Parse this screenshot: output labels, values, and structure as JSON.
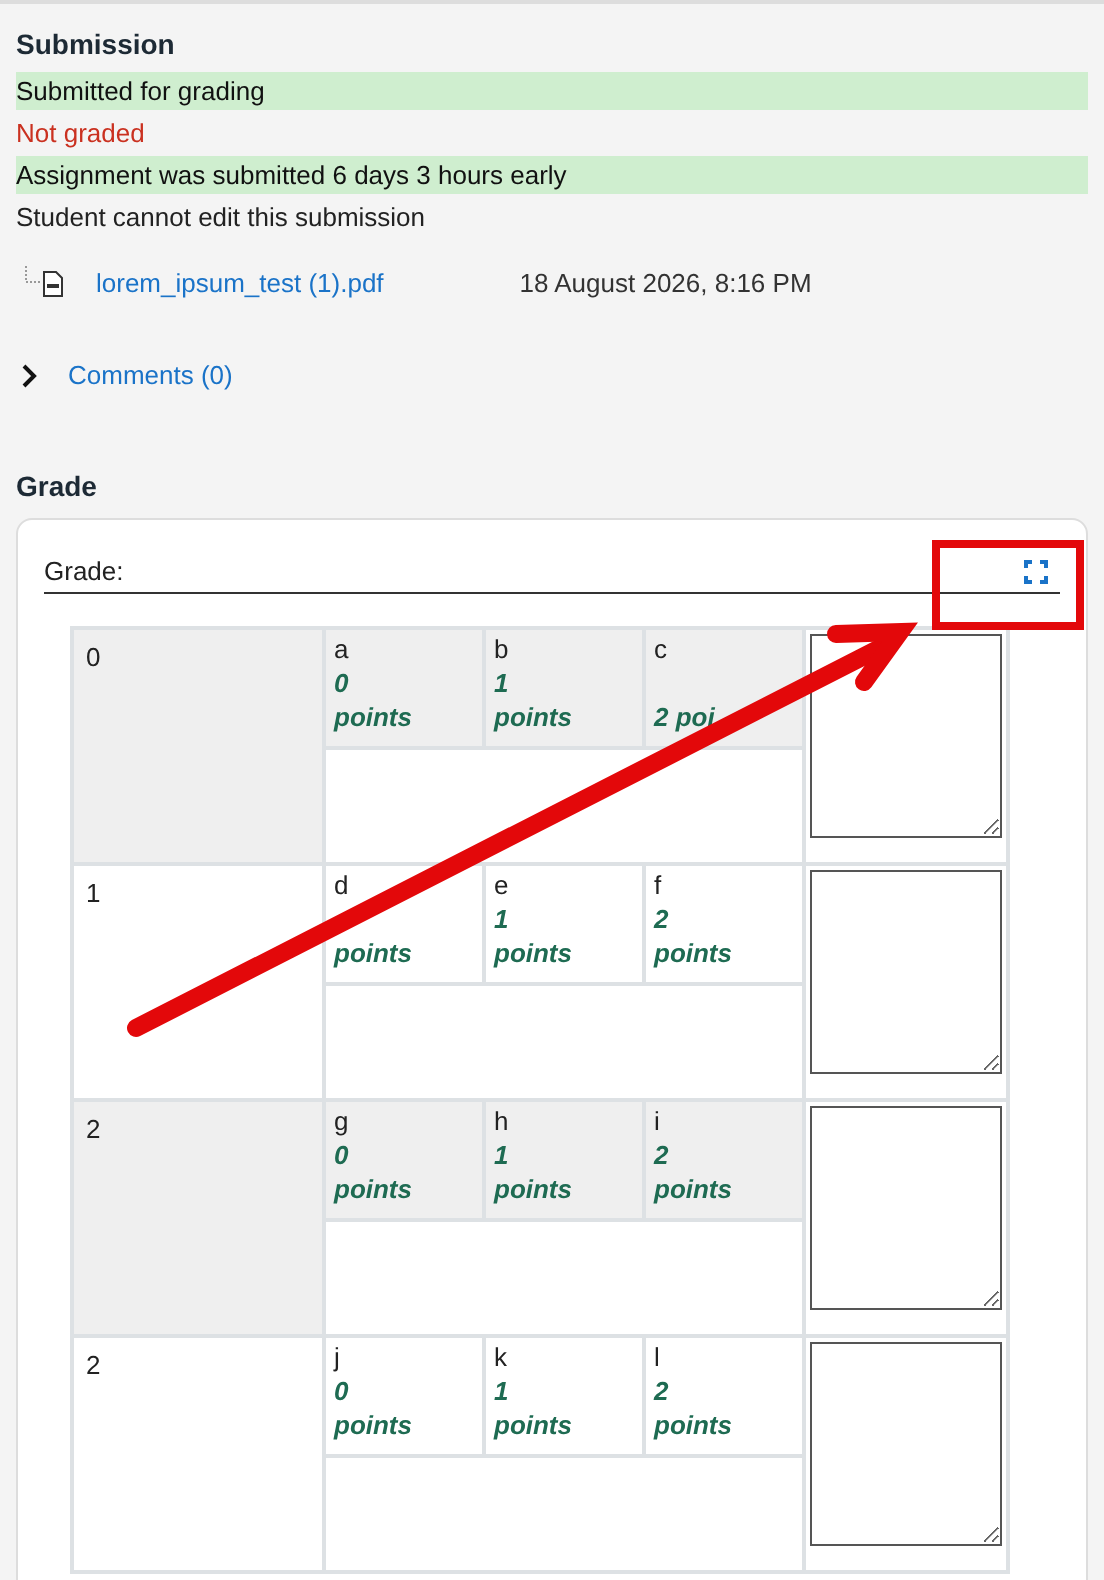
{
  "submission": {
    "title": "Submission",
    "statuses": [
      {
        "text": "Submitted for grading",
        "kind": "success"
      },
      {
        "text": "Not graded",
        "kind": "danger"
      },
      {
        "text": "Assignment was submitted 6 days 3 hours early",
        "kind": "success"
      },
      {
        "text": "Student cannot edit this submission",
        "kind": "plain"
      }
    ],
    "file": {
      "name": "lorem_ipsum_test (1).pdf",
      "date": "18 August 2026, 8:16 PM"
    },
    "comments": {
      "label": "Comments (0)",
      "expanded": false
    }
  },
  "grade": {
    "title": "Grade",
    "label": "Grade:",
    "criteria": [
      {
        "description": "0",
        "levels": [
          {
            "definition": "a",
            "score": "0 points"
          },
          {
            "definition": "b",
            "score": "1 points"
          },
          {
            "definition": "c",
            "score": "2 poi"
          }
        ]
      },
      {
        "description": "1",
        "levels": [
          {
            "definition": "d",
            "score": "points"
          },
          {
            "definition": "e",
            "score": "1 points"
          },
          {
            "definition": "f",
            "score": "2 points"
          }
        ]
      },
      {
        "description": "2",
        "levels": [
          {
            "definition": "g",
            "score": "0 points"
          },
          {
            "definition": "h",
            "score": "1 points"
          },
          {
            "definition": "i",
            "score": "2 points"
          }
        ]
      },
      {
        "description": "2",
        "levels": [
          {
            "definition": "j",
            "score": "0 points"
          },
          {
            "definition": "k",
            "score": "1 points"
          },
          {
            "definition": "l",
            "score": "2 points"
          }
        ]
      }
    ]
  }
}
